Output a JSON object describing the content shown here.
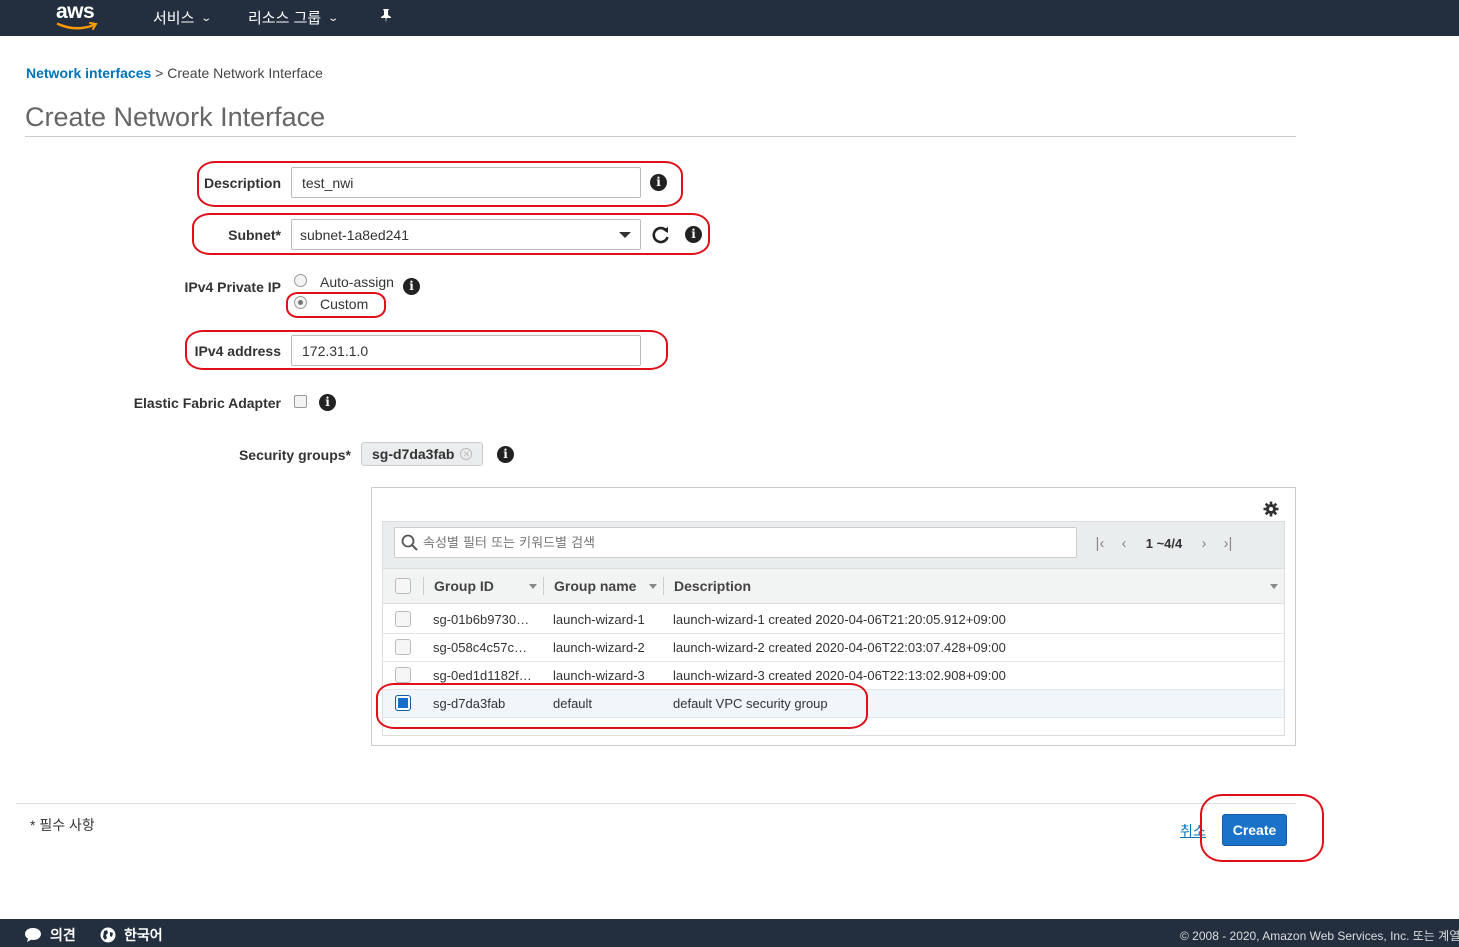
{
  "topnav": {
    "logo_text": "aws",
    "services_label": "서비스",
    "resource_groups_label": "리소스 그룹"
  },
  "breadcrumb": {
    "parent_link": "Network interfaces",
    "separator": ">",
    "current": "Create Network Interface"
  },
  "page_title": "Create Network Interface",
  "form": {
    "description_label": "Description",
    "description_value": "test_nwi",
    "subnet_label": "Subnet*",
    "subnet_value": "subnet-1a8ed241",
    "ipv4_private_ip_label": "IPv4 Private IP",
    "ipv4_options": [
      {
        "label": "Auto-assign",
        "selected": false
      },
      {
        "label": "Custom",
        "selected": true
      }
    ],
    "ipv4_address_label": "IPv4 address",
    "ipv4_address_value": "172.31.1.0",
    "efa_label": "Elastic Fabric Adapter",
    "efa_checked": false,
    "security_groups_label": "Security groups*",
    "security_group_token": "sg-d7da3fab"
  },
  "sg_table": {
    "search_placeholder": "속성별 필터 또는 키워드별 검색",
    "pagination": "1 ~4/4",
    "columns": [
      "Group ID",
      "Group name",
      "Description"
    ],
    "rows": [
      {
        "group_id": "sg-01b6b9730…",
        "group_name": "launch-wizard-1",
        "description": "launch-wizard-1 created 2020-04-06T21:20:05.912+09:00",
        "selected": false
      },
      {
        "group_id": "sg-058c4c57c…",
        "group_name": "launch-wizard-2",
        "description": "launch-wizard-2 created 2020-04-06T22:03:07.428+09:00",
        "selected": false
      },
      {
        "group_id": "sg-0ed1d1182f…",
        "group_name": "launch-wizard-3",
        "description": "launch-wizard-3 created 2020-04-06T22:13:02.908+09:00",
        "selected": false
      },
      {
        "group_id": "sg-d7da3fab",
        "group_name": "default",
        "description": "default VPC security group",
        "selected": true
      }
    ]
  },
  "actions": {
    "required_note": "* 필수 사항",
    "cancel_label": "취소",
    "create_label": "Create"
  },
  "footer": {
    "feedback_label": "의견",
    "language_label": "한국어",
    "copyright": "© 2008 - 2020, Amazon Web Services, Inc. 또는 계열"
  },
  "colors": {
    "nav_bg": "#232f3e",
    "link": "#0073bb",
    "primary_button": "#1a73c9",
    "annotation": "#e0101a"
  }
}
